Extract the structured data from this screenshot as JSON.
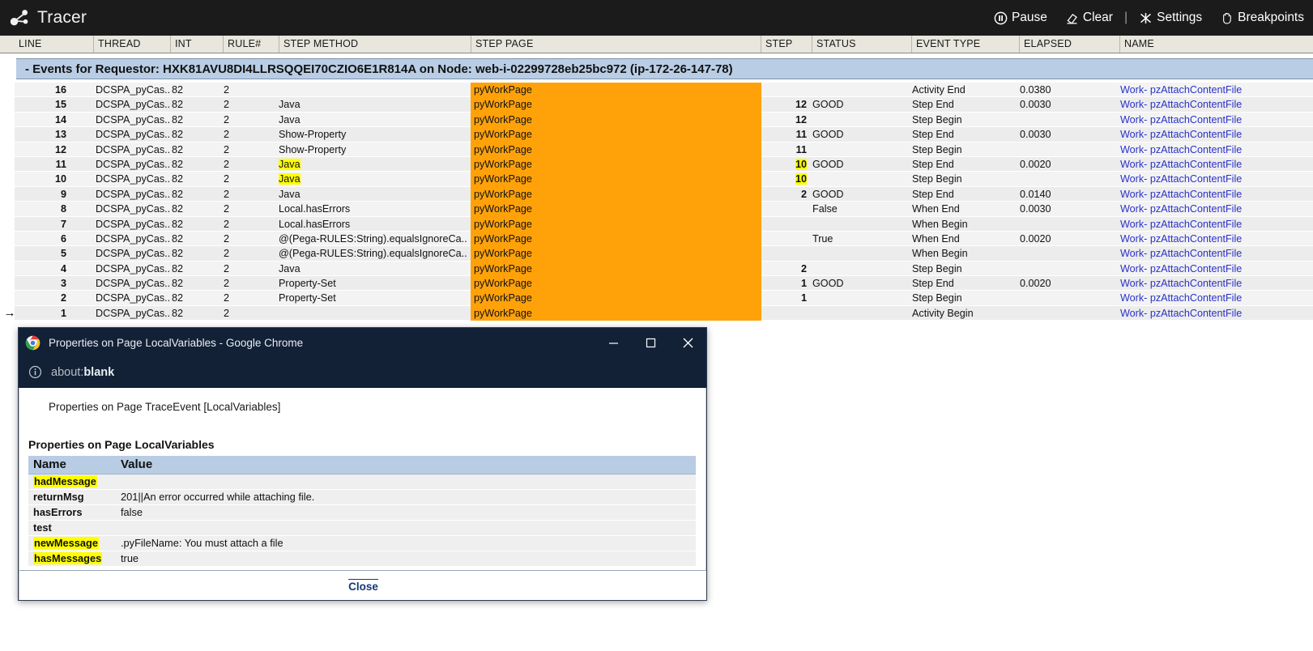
{
  "app": {
    "title": "Tracer",
    "logo_icon": "graph-node-icon",
    "actions": [
      {
        "label": "Pause",
        "icon": "pause-icon"
      },
      {
        "label": "Clear",
        "icon": "eraser-icon"
      },
      {
        "label": "Settings",
        "icon": "tools-icon"
      },
      {
        "label": "Breakpoints",
        "icon": "hand-icon"
      }
    ],
    "separator": "|"
  },
  "grid": {
    "columns": [
      {
        "key": "line",
        "label": "LINE"
      },
      {
        "key": "thread",
        "label": "THREAD"
      },
      {
        "key": "int",
        "label": "INT"
      },
      {
        "key": "rule",
        "label": "RULE#"
      },
      {
        "key": "method",
        "label": "STEP METHOD"
      },
      {
        "key": "page",
        "label": "STEP PAGE"
      },
      {
        "key": "step",
        "label": "STEP"
      },
      {
        "key": "status",
        "label": "STATUS"
      },
      {
        "key": "event",
        "label": "EVENT TYPE"
      },
      {
        "key": "elapsed",
        "label": "ELAPSED"
      },
      {
        "key": "name",
        "label": "NAME"
      }
    ],
    "banner": "- Events for Requestor: HXK81AVU8DI4LLRSQQEI70CZIO6E1R814A on Node: web-i-02299728eb25bc972 (ip-172-26-147-78)",
    "marker_glyph": "→",
    "rows": [
      {
        "marker": "",
        "line": "16",
        "thread": "DCSPA_pyCas...",
        "int": "82",
        "rule": "2",
        "method": "",
        "method_hl": false,
        "page": "pyWorkPage",
        "step": "",
        "step_hl": false,
        "status": "",
        "event": "Activity End",
        "elapsed": "0.0380",
        "name": "Work- pzAttachContentFile"
      },
      {
        "marker": "",
        "line": "15",
        "thread": "DCSPA_pyCas...",
        "int": "82",
        "rule": "2",
        "method": "Java",
        "method_hl": false,
        "page": "pyWorkPage",
        "step": "12",
        "step_hl": false,
        "status": "GOOD",
        "event": "Step End",
        "elapsed": "0.0030",
        "name": "Work- pzAttachContentFile"
      },
      {
        "marker": "",
        "line": "14",
        "thread": "DCSPA_pyCas...",
        "int": "82",
        "rule": "2",
        "method": "Java",
        "method_hl": false,
        "page": "pyWorkPage",
        "step": "12",
        "step_hl": false,
        "status": "",
        "event": "Step Begin",
        "elapsed": "",
        "name": "Work- pzAttachContentFile"
      },
      {
        "marker": "",
        "line": "13",
        "thread": "DCSPA_pyCas...",
        "int": "82",
        "rule": "2",
        "method": "Show-Property",
        "method_hl": false,
        "page": "pyWorkPage",
        "step": "11",
        "step_hl": false,
        "status": "GOOD",
        "event": "Step End",
        "elapsed": "0.0030",
        "name": "Work- pzAttachContentFile"
      },
      {
        "marker": "",
        "line": "12",
        "thread": "DCSPA_pyCas...",
        "int": "82",
        "rule": "2",
        "method": "Show-Property",
        "method_hl": false,
        "page": "pyWorkPage",
        "step": "11",
        "step_hl": false,
        "status": "",
        "event": "Step Begin",
        "elapsed": "",
        "name": "Work- pzAttachContentFile"
      },
      {
        "marker": "",
        "line": "11",
        "thread": "DCSPA_pyCas...",
        "int": "82",
        "rule": "2",
        "method": "Java",
        "method_hl": true,
        "page": "pyWorkPage",
        "step": "10",
        "step_hl": true,
        "status": "GOOD",
        "event": "Step End",
        "elapsed": "0.0020",
        "name": "Work- pzAttachContentFile"
      },
      {
        "marker": "",
        "line": "10",
        "thread": "DCSPA_pyCas...",
        "int": "82",
        "rule": "2",
        "method": "Java",
        "method_hl": true,
        "page": "pyWorkPage",
        "step": "10",
        "step_hl": true,
        "status": "",
        "event": "Step Begin",
        "elapsed": "",
        "name": "Work- pzAttachContentFile"
      },
      {
        "marker": "",
        "line": "9",
        "thread": "DCSPA_pyCas...",
        "int": "82",
        "rule": "2",
        "method": "Java",
        "method_hl": false,
        "page": "pyWorkPage",
        "step": "2",
        "step_hl": false,
        "status": "GOOD",
        "event": "Step End",
        "elapsed": "0.0140",
        "name": "Work- pzAttachContentFile"
      },
      {
        "marker": "",
        "line": "8",
        "thread": "DCSPA_pyCas...",
        "int": "82",
        "rule": "2",
        "method": "Local.hasErrors",
        "method_hl": false,
        "page": "pyWorkPage",
        "step": "",
        "step_hl": false,
        "status": "False",
        "event": "When End",
        "elapsed": "0.0030",
        "name": "Work- pzAttachContentFile"
      },
      {
        "marker": "",
        "line": "7",
        "thread": "DCSPA_pyCas...",
        "int": "82",
        "rule": "2",
        "method": "Local.hasErrors",
        "method_hl": false,
        "page": "pyWorkPage",
        "step": "",
        "step_hl": false,
        "status": "",
        "event": "When Begin",
        "elapsed": "",
        "name": "Work- pzAttachContentFile"
      },
      {
        "marker": "",
        "line": "6",
        "thread": "DCSPA_pyCas...",
        "int": "82",
        "rule": "2",
        "method": "@(Pega-RULES:String).equalsIgnoreCa...",
        "method_hl": false,
        "page": "pyWorkPage",
        "step": "",
        "step_hl": false,
        "status": "True",
        "event": "When End",
        "elapsed": "0.0020",
        "name": "Work- pzAttachContentFile"
      },
      {
        "marker": "",
        "line": "5",
        "thread": "DCSPA_pyCas...",
        "int": "82",
        "rule": "2",
        "method": "@(Pega-RULES:String).equalsIgnoreCa...",
        "method_hl": false,
        "page": "pyWorkPage",
        "step": "",
        "step_hl": false,
        "status": "",
        "event": "When Begin",
        "elapsed": "",
        "name": "Work- pzAttachContentFile"
      },
      {
        "marker": "",
        "line": "4",
        "thread": "DCSPA_pyCas...",
        "int": "82",
        "rule": "2",
        "method": "Java",
        "method_hl": false,
        "page": "pyWorkPage",
        "step": "2",
        "step_hl": false,
        "status": "",
        "event": "Step Begin",
        "elapsed": "",
        "name": "Work- pzAttachContentFile"
      },
      {
        "marker": "",
        "line": "3",
        "thread": "DCSPA_pyCas...",
        "int": "82",
        "rule": "2",
        "method": "Property-Set",
        "method_hl": false,
        "page": "pyWorkPage",
        "step": "1",
        "step_hl": false,
        "status": "GOOD",
        "event": "Step End",
        "elapsed": "0.0020",
        "name": "Work- pzAttachContentFile"
      },
      {
        "marker": "",
        "line": "2",
        "thread": "DCSPA_pyCas...",
        "int": "82",
        "rule": "2",
        "method": "Property-Set",
        "method_hl": false,
        "page": "pyWorkPage",
        "step": "1",
        "step_hl": false,
        "status": "",
        "event": "Step Begin",
        "elapsed": "",
        "name": "Work- pzAttachContentFile"
      },
      {
        "marker": "→",
        "line": "1",
        "thread": "DCSPA_pyCas...",
        "int": "82",
        "rule": "2",
        "method": "",
        "method_hl": false,
        "page": "pyWorkPage",
        "step": "",
        "step_hl": false,
        "status": "",
        "event": "Activity Begin",
        "elapsed": "",
        "name": "Work- pzAttachContentFile"
      }
    ]
  },
  "dialog": {
    "window_title": "Properties on Page LocalVariables - Google Chrome",
    "url": "about:blank",
    "url_scheme": "about:",
    "url_rest": "blank",
    "info_icon": "info-circle-icon",
    "chrome_icon": "chrome-logo-icon",
    "minimize_icon": "minimize-icon",
    "maximize_icon": "maximize-icon",
    "close_window_icon": "close-icon",
    "subtitle": "Properties on Page TraceEvent [LocalVariables]",
    "heading": "Properties on Page LocalVariables",
    "table": {
      "headers": [
        "Name",
        "Value"
      ],
      "rows": [
        {
          "name": "hadMessage",
          "name_hl": true,
          "value": ""
        },
        {
          "name": "returnMsg",
          "name_hl": false,
          "value": "201||An error occurred while attaching file."
        },
        {
          "name": "hasErrors",
          "name_hl": false,
          "value": "false"
        },
        {
          "name": "test",
          "name_hl": false,
          "value": ""
        },
        {
          "name": "newMessage",
          "name_hl": true,
          "value": ".pyFileName: You must attach a file"
        },
        {
          "name": "hasMessages",
          "name_hl": true,
          "value": "true"
        }
      ]
    },
    "close_label": "Close"
  },
  "colors": {
    "app_bar_bg": "#1b1b1b",
    "grid_header_bg": "#e8e6dd",
    "banner_bg": "#b9cde4",
    "step_page_orange": "#ffa20a",
    "highlight_yellow": "#ffff00",
    "link_blue": "#2a31c8",
    "chrome_titlebar": "#122136",
    "close_link": "#14397a"
  }
}
